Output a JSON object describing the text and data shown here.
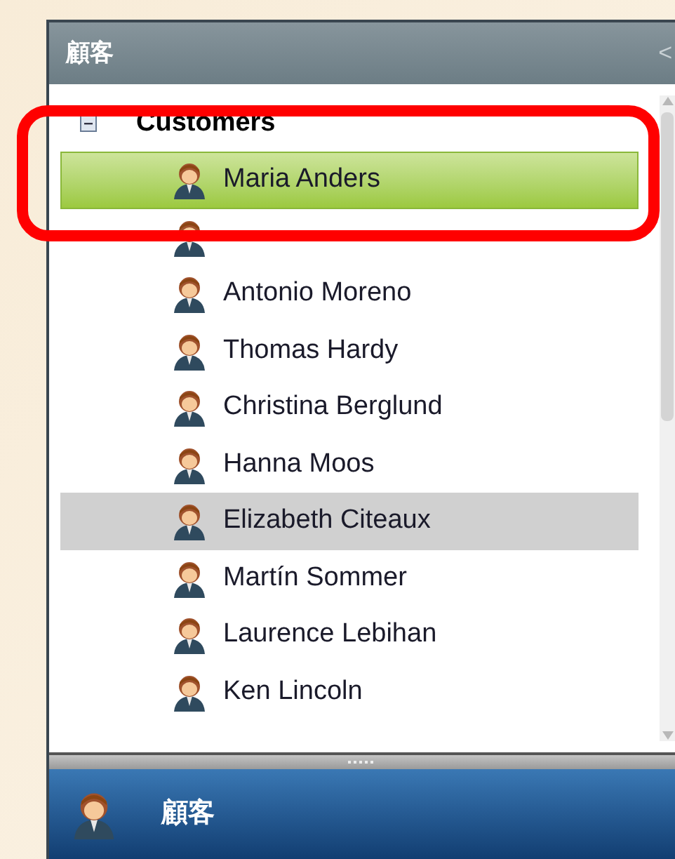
{
  "panel": {
    "title": "顧客",
    "collapse_glyph": "<"
  },
  "tree": {
    "label": "Customers",
    "expanded": true,
    "children": [
      {
        "label": "Maria Anders",
        "selected": true,
        "hovered": false
      },
      {
        "selected": false,
        "hovered": false
      },
      {
        "label": "Antonio Moreno",
        "selected": false,
        "hovered": false
      },
      {
        "label": "Thomas Hardy",
        "selected": false,
        "hovered": false
      },
      {
        "label": "Christina Berglund",
        "selected": false,
        "hovered": false
      },
      {
        "label": "Hanna Moos",
        "selected": false,
        "hovered": false
      },
      {
        "label": "Elizabeth Citeaux",
        "selected": false,
        "hovered": true
      },
      {
        "label": "Martín Sommer",
        "selected": false,
        "hovered": false
      },
      {
        "label": "Laurence Lebihan",
        "selected": false,
        "hovered": false
      },
      {
        "label": "Ken Lincoln",
        "selected": false,
        "hovered": false
      }
    ]
  },
  "footer": {
    "label": "顧客"
  }
}
